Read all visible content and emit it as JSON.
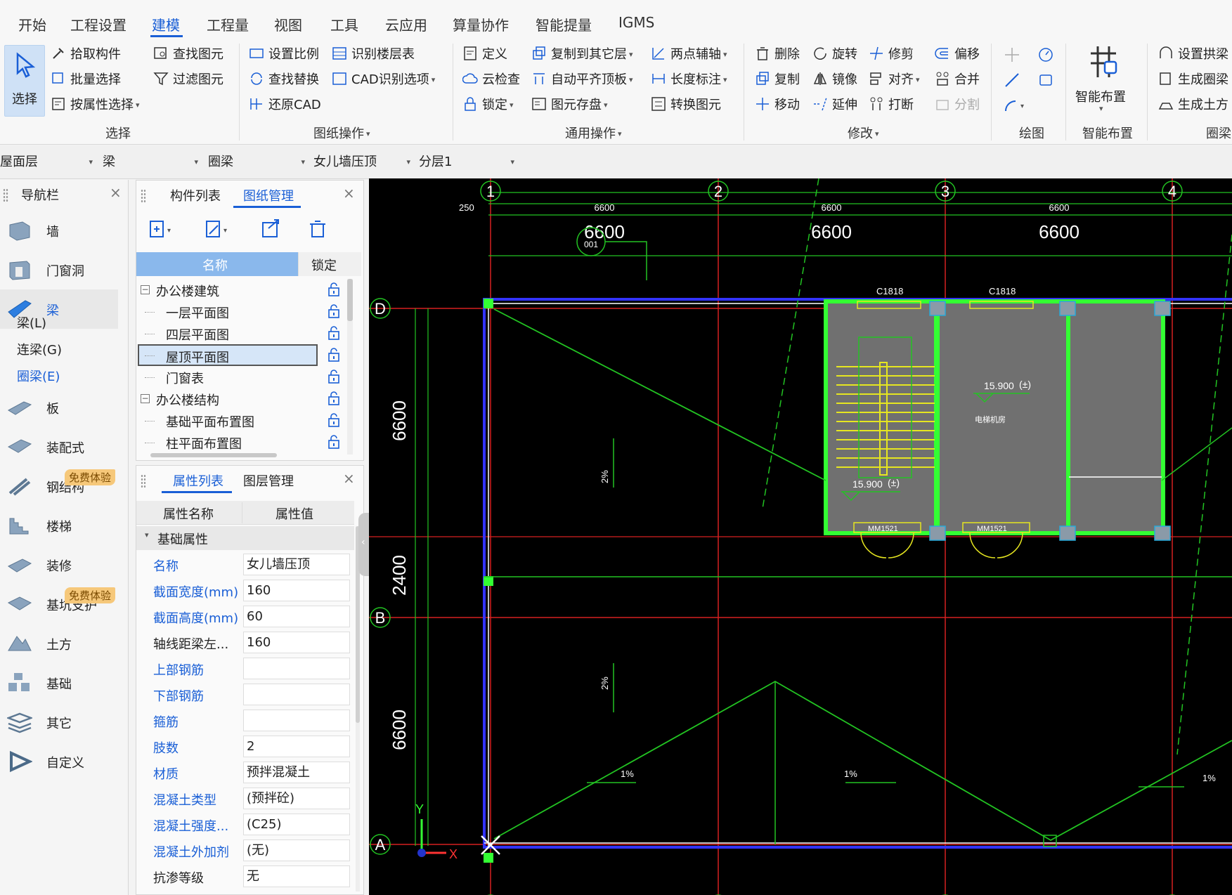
{
  "menu": {
    "items": [
      "开始",
      "工程设置",
      "建模",
      "工程量",
      "视图",
      "工具",
      "云应用",
      "算量协作",
      "智能提量",
      "IGMS"
    ],
    "active": "建模"
  },
  "ribbon": {
    "select": {
      "label": "选择",
      "pick": "拾取构件",
      "batch": "批量选择",
      "by_attr": "按属性选择",
      "find": "查找图元",
      "filter": "过滤图元",
      "title": "选择"
    },
    "drawing": {
      "scale": "设置比例",
      "find_replace": "查找替换",
      "restore": "还原CAD",
      "floor_table": "识别楼层表",
      "cad_options": "CAD识别选项",
      "title": "图纸操作"
    },
    "general": {
      "define": "定义",
      "cloud_check": "云检查",
      "lock": "锁定",
      "copy_to": "复制到其它层",
      "auto_slab": "自动平齐顶板",
      "save_elem": "图元存盘",
      "two_point": "两点辅轴",
      "dim": "长度标注",
      "convert": "转换图元",
      "title": "通用操作"
    },
    "modify": {
      "delete": "删除",
      "rotate": "旋转",
      "trim": "修剪",
      "offset": "偏移",
      "copy": "复制",
      "mirror": "镜像",
      "align": "对齐",
      "merge": "合并",
      "move": "移动",
      "extend": "延伸",
      "break": "打断",
      "split": "分割",
      "title": "修改"
    },
    "draw": {
      "title": "绘图"
    },
    "smart": {
      "label": "智能布置",
      "title": "智能布置"
    },
    "beam": {
      "arch": "设置拱梁",
      "gen_ring": "生成圈梁",
      "gen_earth": "生成土方",
      "title": "圈梁"
    }
  },
  "selectors": [
    "屋面层",
    "梁",
    "圈梁",
    "女儿墙压顶",
    "分层1"
  ],
  "nav": {
    "title": "导航栏",
    "items": [
      "墙",
      "门窗洞",
      "梁",
      "板",
      "装配式",
      "钢结构",
      "楼梯",
      "装修",
      "基坑支护",
      "土方",
      "基础",
      "其它",
      "自定义"
    ],
    "sub_items": [
      "梁(L)",
      "连梁(G)",
      "圈梁(E)"
    ],
    "active_sub": "圈梁(E)",
    "badge": "免费体验"
  },
  "components": {
    "tabs": [
      "构件列表",
      "图纸管理"
    ],
    "col_name": "名称",
    "col_lock": "锁定",
    "rows": [
      {
        "label": "办公楼建筑",
        "group": true
      },
      {
        "label": "一层平面图",
        "group": false
      },
      {
        "label": "四层平面图",
        "group": false
      },
      {
        "label": "屋顶平面图",
        "group": false,
        "selected": true
      },
      {
        "label": "门窗表",
        "group": false
      },
      {
        "label": "办公楼结构",
        "group": true
      },
      {
        "label": "基础平面布置图",
        "group": false
      },
      {
        "label": "柱平面布置图",
        "group": false
      }
    ]
  },
  "properties": {
    "tabs": [
      "属性列表",
      "图层管理"
    ],
    "col_name": "属性名称",
    "col_value": "属性值",
    "section": "基础属性",
    "rows": [
      {
        "name": "名称",
        "value": "女儿墙压顶",
        "blue": true
      },
      {
        "name": "截面宽度(mm)",
        "value": "160",
        "blue": true
      },
      {
        "name": "截面高度(mm)",
        "value": "60",
        "blue": true
      },
      {
        "name": "轴线距梁左...",
        "value": "160",
        "blue": false
      },
      {
        "name": "上部钢筋",
        "value": "",
        "blue": true
      },
      {
        "name": "下部钢筋",
        "value": "",
        "blue": true
      },
      {
        "name": "箍筋",
        "value": "",
        "blue": true
      },
      {
        "name": "肢数",
        "value": "2",
        "blue": true
      },
      {
        "name": "材质",
        "value": "预拌混凝土",
        "blue": true
      },
      {
        "name": "混凝土类型",
        "value": "(预拌砼)",
        "blue": true
      },
      {
        "name": "混凝土强度...",
        "value": "(C25)",
        "blue": true
      },
      {
        "name": "混凝土外加剂",
        "value": "(无)",
        "blue": true
      },
      {
        "name": "抗渗等级",
        "value": "无",
        "blue": false
      }
    ]
  },
  "canvas": {
    "axes_top": [
      "1",
      "2",
      "3",
      "4"
    ],
    "axes_left": [
      "D",
      "B",
      "A"
    ],
    "dims_top_small": [
      "250",
      "6600",
      "6600",
      "6600"
    ],
    "dims_top_big": [
      "6600",
      "6600",
      "6600"
    ],
    "dims_left": [
      "6600",
      "2400",
      "6600"
    ],
    "labels": {
      "c1818": "C1818",
      "mm1521": "MM1521",
      "elev": "15.900",
      "elev_mark": "(±)",
      "room": "电梯机房",
      "slope": "1%",
      "slope2": "2%",
      "tag": "001",
      "x": "X",
      "y": "Y"
    },
    "colors": {
      "grid": "#d62020",
      "line": "#22c322",
      "bright": "#33ff33",
      "yellow": "#e6e620",
      "wall": "#3333ff",
      "room": "#707070"
    }
  }
}
